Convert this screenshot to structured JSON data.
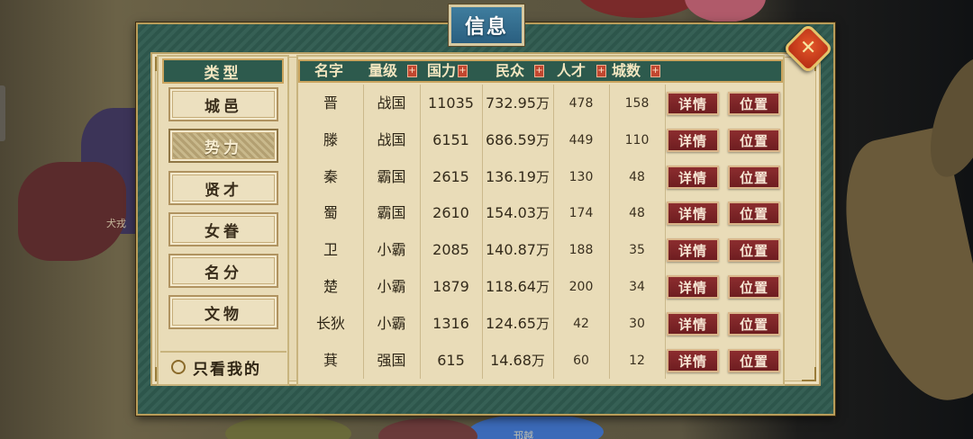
{
  "map": {
    "labels": [
      {
        "name": "map-label-dayong",
        "text": "犬戎"
      },
      {
        "name": "map-label-bottom",
        "text": "邗越"
      }
    ]
  },
  "panel": {
    "title": "信息",
    "close_label": "✕"
  },
  "categories": {
    "header": "类型",
    "items": [
      "城邑",
      "势力",
      "贤才",
      "女眷",
      "名分",
      "文物"
    ],
    "active_index": 1,
    "only_mine_label": "只看我的",
    "only_mine_checked": false
  },
  "table": {
    "columns": [
      {
        "key": "name",
        "label": "名字",
        "sortable": false
      },
      {
        "key": "tier",
        "label": "量级",
        "sortable": true
      },
      {
        "key": "power",
        "label": "国力",
        "sortable": true
      },
      {
        "key": "population",
        "label": "民众",
        "sortable": true
      },
      {
        "key": "talent",
        "label": "人才",
        "sortable": true
      },
      {
        "key": "cities",
        "label": "城数",
        "sortable": true
      }
    ],
    "sort_icon": "+",
    "detail_label": "详情",
    "locate_label": "位置",
    "rows": [
      {
        "name": "晋",
        "tier": "战国",
        "power": "11035",
        "pop": "732.95",
        "unit": "万",
        "talent": "478",
        "cities": "158"
      },
      {
        "name": "滕",
        "tier": "战国",
        "power": "6151",
        "pop": "686.59",
        "unit": "万",
        "talent": "449",
        "cities": "110"
      },
      {
        "name": "秦",
        "tier": "霸国",
        "power": "2615",
        "pop": "136.19",
        "unit": "万",
        "talent": "130",
        "cities": "48"
      },
      {
        "name": "蜀",
        "tier": "霸国",
        "power": "2610",
        "pop": "154.03",
        "unit": "万",
        "talent": "174",
        "cities": "48"
      },
      {
        "name": "卫",
        "tier": "小霸",
        "power": "2085",
        "pop": "140.87",
        "unit": "万",
        "talent": "188",
        "cities": "35"
      },
      {
        "name": "楚",
        "tier": "小霸",
        "power": "1879",
        "pop": "118.64",
        "unit": "万",
        "talent": "200",
        "cities": "34"
      },
      {
        "name": "长狄",
        "tier": "小霸",
        "power": "1316",
        "pop": "124.65",
        "unit": "万",
        "talent": "42",
        "cities": "30"
      },
      {
        "name": "萁",
        "tier": "强国",
        "power": "615",
        "pop": "14.68",
        "unit": "万",
        "talent": "60",
        "cities": "12"
      }
    ]
  },
  "colors": {
    "panel_green": "#2f5a4f",
    "parchment": "#e7d9b3",
    "button_red": "#7a2326",
    "gold_border": "#b99d5a"
  }
}
